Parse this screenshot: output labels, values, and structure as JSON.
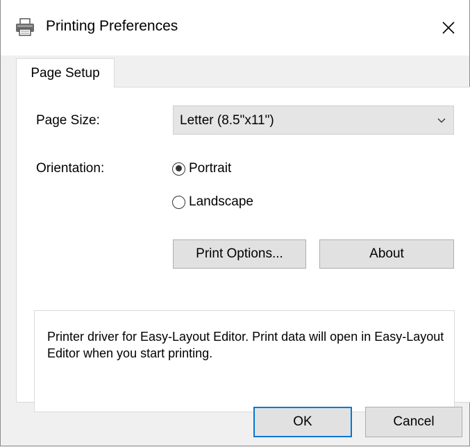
{
  "window": {
    "title": "Printing Preferences",
    "title_icon": "printer-icon",
    "close_glyph": "✕"
  },
  "tabs": [
    {
      "label": "Page Setup",
      "active": true
    }
  ],
  "page_size": {
    "label": "Page Size:",
    "value": "Letter (8.5\"x11\")"
  },
  "orientation": {
    "label": "Orientation:",
    "options": [
      {
        "label": "Portrait",
        "checked": true
      },
      {
        "label": "Landscape",
        "checked": false
      }
    ]
  },
  "buttons": {
    "print_options": "Print Options...",
    "about": "About",
    "ok": "OK",
    "cancel": "Cancel"
  },
  "description": "Printer driver for Easy-Layout Editor. Print data will open in Easy-Layout Editor when you start printing.",
  "colors": {
    "accent": "#0078d7",
    "button_face": "#e1e1e1",
    "window_bg": "#f0f0f0"
  }
}
